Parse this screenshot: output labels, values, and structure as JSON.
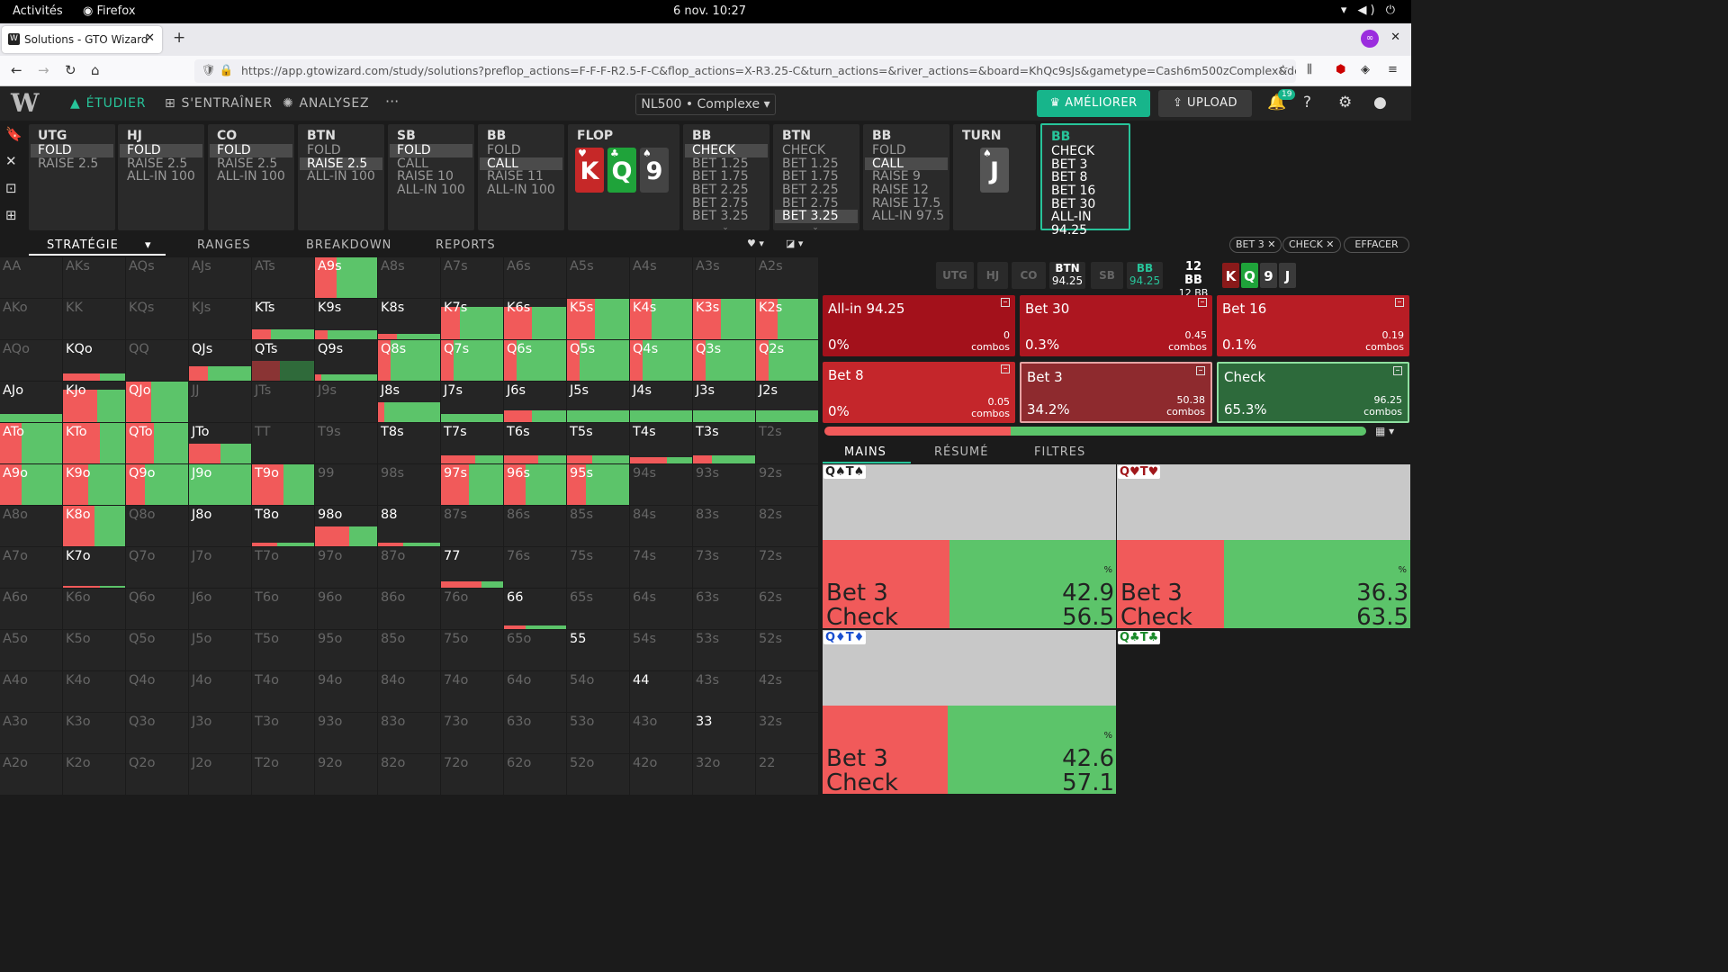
{
  "os": {
    "activities": "Activités",
    "app": "Firefox",
    "clock": "6 nov.  10:27"
  },
  "browser": {
    "tab_title": "Solutions - GTO Wizard",
    "url": "https://app.gtowizard.com/study/solutions?preflop_actions=F-F-F-R2.5-F-C&flop_actions=X-R3.25-C&turn_actions=&river_actions=&board=KhQc9sJs&gametype=Cash6m500zComplex&depth=100&stac"
  },
  "app": {
    "nav": {
      "study": "ÉTUDIER",
      "train": "S'ENTRAÎNER",
      "analyze": "ANALYSEZ",
      "more": "···"
    },
    "game_type": "NL500 • Complexe",
    "upgrade": "AMÉLIORER",
    "upload": "UPLOAD",
    "notif_count": "19"
  },
  "positions": [
    {
      "name": "UTG",
      "actions": [
        "FOLD",
        "RAISE 2.5"
      ],
      "sel": 0
    },
    {
      "name": "HJ",
      "actions": [
        "FOLD",
        "RAISE 2.5",
        "ALL-IN 100"
      ],
      "sel": 0
    },
    {
      "name": "CO",
      "actions": [
        "FOLD",
        "RAISE 2.5",
        "ALL-IN 100"
      ],
      "sel": 0
    },
    {
      "name": "BTN",
      "actions": [
        "FOLD",
        "RAISE 2.5",
        "ALL-IN 100"
      ],
      "sel": 1
    },
    {
      "name": "SB",
      "actions": [
        "FOLD",
        "CALL",
        "RAISE 10",
        "ALL-IN 100"
      ],
      "sel": 0
    },
    {
      "name": "BB",
      "actions": [
        "FOLD",
        "CALL",
        "RAISE 11",
        "ALL-IN 100"
      ],
      "sel": 1
    },
    {
      "name": "FLOP"
    },
    {
      "name": "BB",
      "actions": [
        "CHECK",
        "BET 1.25",
        "BET 1.75",
        "BET 2.25",
        "BET 2.75",
        "BET 3.25"
      ],
      "sel": 0
    },
    {
      "name": "BTN",
      "actions": [
        "CHECK",
        "BET 1.25",
        "BET 1.75",
        "BET 2.25",
        "BET 2.75",
        "BET 3.25"
      ],
      "sel": 5
    },
    {
      "name": "BB",
      "actions": [
        "FOLD",
        "CALL",
        "RAISE 9",
        "RAISE 12",
        "RAISE 17.5",
        "ALL-IN 97.5"
      ],
      "sel": 1
    },
    {
      "name": "TURN"
    },
    {
      "name": "BB",
      "actions": [
        "CHECK",
        "BET 3",
        "BET 8",
        "BET 16",
        "BET 30",
        "ALL-IN 94.25"
      ],
      "sel": -1
    }
  ],
  "flop_cards": [
    {
      "rank": "K",
      "suit": "♥",
      "color": "#c62828"
    },
    {
      "rank": "Q",
      "suit": "♣",
      "color": "#1fa33a"
    },
    {
      "rank": "9",
      "suit": "♠",
      "color": "#444"
    }
  ],
  "turn_card": {
    "rank": "J",
    "suit": "♠",
    "color": "#555"
  },
  "subtabs": [
    "STRATÉGIE",
    "RANGES",
    "BREAKDOWN",
    "REPORTS"
  ],
  "filter_chips": [
    "BET 3 ✕",
    "CHECK ✕",
    "EFFACER"
  ],
  "grid": {
    "labels": [
      [
        "AA",
        "AKs",
        "AQs",
        "AJs",
        "ATs",
        "A9s",
        "A8s",
        "A7s",
        "A6s",
        "A5s",
        "A4s",
        "A3s",
        "A2s"
      ],
      [
        "AKo",
        "KK",
        "KQs",
        "KJs",
        "KTs",
        "K9s",
        "K8s",
        "K7s",
        "K6s",
        "K5s",
        "K4s",
        "K3s",
        "K2s"
      ],
      [
        "AQo",
        "KQo",
        "QQ",
        "QJs",
        "QTs",
        "Q9s",
        "Q8s",
        "Q7s",
        "Q6s",
        "Q5s",
        "Q4s",
        "Q3s",
        "Q2s"
      ],
      [
        "AJo",
        "KJo",
        "QJo",
        "JJ",
        "JTs",
        "J9s",
        "J8s",
        "J7s",
        "J6s",
        "J5s",
        "J4s",
        "J3s",
        "J2s"
      ],
      [
        "ATo",
        "KTo",
        "QTo",
        "JTo",
        "TT",
        "T9s",
        "T8s",
        "T7s",
        "T6s",
        "T5s",
        "T4s",
        "T3s",
        "T2s"
      ],
      [
        "A9o",
        "K9o",
        "Q9o",
        "J9o",
        "T9o",
        "99",
        "98s",
        "97s",
        "96s",
        "95s",
        "94s",
        "93s",
        "92s"
      ],
      [
        "A8o",
        "K8o",
        "Q8o",
        "J8o",
        "T8o",
        "98o",
        "88",
        "87s",
        "86s",
        "85s",
        "84s",
        "83s",
        "82s"
      ],
      [
        "A7o",
        "K7o",
        "Q7o",
        "J7o",
        "T7o",
        "97o",
        "87o",
        "77",
        "76s",
        "75s",
        "74s",
        "73s",
        "72s"
      ],
      [
        "A6o",
        "K6o",
        "Q6o",
        "J6o",
        "T6o",
        "96o",
        "86o",
        "76o",
        "66",
        "65s",
        "64s",
        "63s",
        "62s"
      ],
      [
        "A5o",
        "K5o",
        "Q5o",
        "J5o",
        "T5o",
        "95o",
        "85o",
        "75o",
        "65o",
        "55",
        "54s",
        "53s",
        "52s"
      ],
      [
        "A4o",
        "K4o",
        "Q4o",
        "J4o",
        "T4o",
        "94o",
        "84o",
        "74o",
        "64o",
        "54o",
        "44",
        "43s",
        "42s"
      ],
      [
        "A3o",
        "K3o",
        "Q3o",
        "J3o",
        "T3o",
        "93o",
        "83o",
        "73o",
        "63o",
        "53o",
        "43o",
        "33",
        "32s"
      ],
      [
        "A2o",
        "K2o",
        "Q2o",
        "J2o",
        "T2o",
        "92o",
        "82o",
        "72o",
        "62o",
        "52o",
        "42o",
        "32o",
        "22"
      ]
    ],
    "cells": {
      "A9s": [
        1.0,
        0.35
      ],
      "KTs": [
        0.25,
        0.3
      ],
      "K9s": [
        0.22,
        0.2
      ],
      "K8s": [
        0.14,
        0.3
      ],
      "K7s": [
        0.8,
        0.3
      ],
      "K6s": [
        0.8,
        0.45
      ],
      "K5s": [
        1.0,
        0.45
      ],
      "K4s": [
        1.0,
        0.35
      ],
      "K3s": [
        1.0,
        0.45
      ],
      "K2s": [
        1.0,
        0.35
      ],
      "KQo": [
        0.18,
        0.6
      ],
      "QJs": [
        0.35,
        0.3
      ],
      "QTs": [
        0.5,
        0.45
      ],
      "Q9s": [
        0.16,
        0.1
      ],
      "Q8s": [
        1.0,
        0.2
      ],
      "Q7s": [
        1.0,
        0.2
      ],
      "Q6s": [
        1.0,
        0.2
      ],
      "Q5s": [
        1.0,
        0.2
      ],
      "Q4s": [
        1.0,
        0.2
      ],
      "Q3s": [
        1.0,
        0.2
      ],
      "Q2s": [
        1.0,
        0.2
      ],
      "AJo": [
        0.2,
        0.0
      ],
      "KJo": [
        0.8,
        0.55
      ],
      "QJo": [
        1.0,
        0.4
      ],
      "J8s": [
        0.5,
        0.1
      ],
      "J7s": [
        0.2,
        0.0
      ],
      "J6s": [
        0.3,
        0.45
      ],
      "J5s": [
        0.3,
        0.0
      ],
      "J4s": [
        0.3,
        0.0
      ],
      "J3s": [
        0.3,
        0.0
      ],
      "J2s": [
        0.3,
        0.0
      ],
      "ATo": [
        1.0,
        0.35
      ],
      "KTo": [
        1.0,
        0.6
      ],
      "QTo": [
        1.0,
        0.45
      ],
      "JTo": [
        0.5,
        0.5
      ],
      "T8s": [
        0.0,
        0.0
      ],
      "T7s": [
        0.2,
        0.55
      ],
      "T6s": [
        0.2,
        0.55
      ],
      "T5s": [
        0.2,
        0.4
      ],
      "T4s": [
        0.15,
        0.6
      ],
      "T3s": [
        0.2,
        0.3
      ],
      "A9o": [
        1.0,
        0.35
      ],
      "K9o": [
        1.0,
        0.4
      ],
      "Q9o": [
        1.0,
        0.3
      ],
      "J9o": [
        1.0,
        0.0
      ],
      "T9o": [
        1.0,
        0.5
      ],
      "97s": [
        1.0,
        0.45
      ],
      "96s": [
        1.0,
        0.35
      ],
      "95s": [
        1.0,
        0.3
      ],
      "K8o": [
        1.0,
        0.5
      ],
      "J8o": [
        0.0,
        0.0
      ],
      "T8o": [
        0.1,
        0.4
      ],
      "98o": [
        0.5,
        0.55
      ],
      "88": [
        0.1,
        0.4
      ],
      "K7o": [
        0.05,
        0.6
      ],
      "77": [
        0.15,
        0.65
      ],
      "66": [
        0.08,
        0.35
      ],
      "55": [
        0.0,
        0.0
      ],
      "44": [
        0.0,
        0.0
      ],
      "33": [
        0.0,
        0.0
      ]
    },
    "in_range": [
      "A9s",
      "KTs",
      "K9s",
      "K8s",
      "K7s",
      "K6s",
      "K5s",
      "K4s",
      "K3s",
      "K2s",
      "KQo",
      "QJs",
      "QTs",
      "Q9s",
      "Q8s",
      "Q7s",
      "Q6s",
      "Q5s",
      "Q4s",
      "Q3s",
      "Q2s",
      "AJo",
      "KJo",
      "QJo",
      "J8s",
      "J7s",
      "J6s",
      "J5s",
      "J4s",
      "J3s",
      "J2s",
      "ATo",
      "KTo",
      "QTo",
      "JTo",
      "T8s",
      "T7s",
      "T6s",
      "T5s",
      "T4s",
      "T3s",
      "A9o",
      "K9o",
      "Q9o",
      "J9o",
      "T9o",
      "97s",
      "96s",
      "95s",
      "K8o",
      "J8o",
      "T8o",
      "98o",
      "88",
      "K7o",
      "77",
      "66",
      "55",
      "44",
      "33"
    ]
  },
  "player_bar": [
    {
      "pos": "UTG",
      "stack": ""
    },
    {
      "pos": "HJ",
      "stack": ""
    },
    {
      "pos": "CO",
      "stack": ""
    },
    {
      "pos": "BTN",
      "stack": "94.25"
    },
    {
      "pos": "SB",
      "stack": ""
    },
    {
      "pos": "BB",
      "stack": "94.25"
    }
  ],
  "pot": {
    "label": "12 BB",
    "sub": "12 BB"
  },
  "board_mini": [
    "K",
    "Q",
    "9",
    "J"
  ],
  "actions": [
    {
      "name": "All-in 94.25",
      "pct": "0%",
      "combos": "0",
      "unit": "combos",
      "color": "#a3111b"
    },
    {
      "name": "Bet 30",
      "pct": "0.3%",
      "combos": "0.45",
      "unit": "combos",
      "color": "#ad1620"
    },
    {
      "name": "Bet 16",
      "pct": "0.1%",
      "combos": "0.19",
      "unit": "combos",
      "color": "#b81d25"
    },
    {
      "name": "Bet 8",
      "pct": "0%",
      "combos": "0.05",
      "unit": "combos",
      "color": "#c4262b"
    },
    {
      "name": "Bet 3",
      "pct": "34.2%",
      "combos": "50.38",
      "unit": "combos",
      "color": "#8e2a2e"
    },
    {
      "name": "Check",
      "pct": "65.3%",
      "combos": "96.25",
      "unit": "combos",
      "color": "#2d6a3b"
    }
  ],
  "freq": {
    "bet": 0.342,
    "check": 0.653
  },
  "right_tabs": [
    "MAINS",
    "RÉSUMÉ",
    "FILTRES"
  ],
  "hands": [
    {
      "label": "Q♠T♠",
      "bet": "42.9",
      "check": "56.5",
      "bet_label": "Bet 3",
      "check_label": "Check",
      "pct_sym": "%",
      "red": false
    },
    {
      "label": "Q♥T♥",
      "bet": "36.3",
      "check": "63.5",
      "bet_label": "Bet 3",
      "check_label": "Check",
      "pct_sym": "%",
      "red": true
    },
    {
      "label": "Q♦T♦",
      "bet": "42.6",
      "check": "57.1",
      "bet_label": "Bet 3",
      "check_label": "Check",
      "pct_sym": "%",
      "red": false
    },
    {
      "label": "Q♣T♣",
      "bet": "",
      "check": "",
      "bet_label": "",
      "check_label": "",
      "pct_sym": "",
      "red": false
    }
  ],
  "colors": {
    "red": "#f15a5a",
    "green": "#5cc46a",
    "accent": "#17b58b"
  }
}
